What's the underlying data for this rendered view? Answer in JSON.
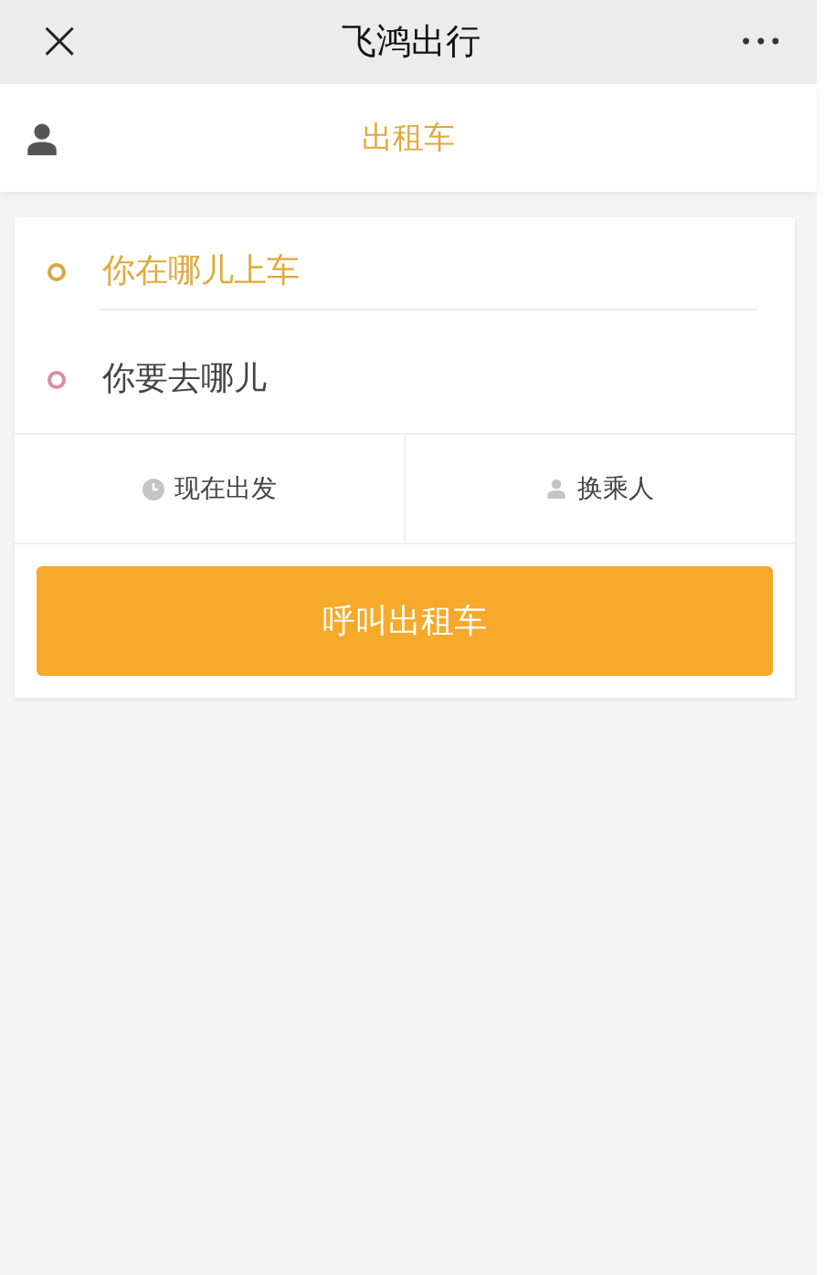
{
  "window": {
    "title": "飞鸿出行",
    "close": "×",
    "more": "•••"
  },
  "service_bar": {
    "title": "出租车"
  },
  "route_fields": [
    {
      "kind": "pickup",
      "placeholder": "你在哪儿上车",
      "color": "#d9a640"
    },
    {
      "kind": "destination",
      "placeholder": "你要去哪儿",
      "color": "#d9909a"
    }
  ],
  "options": [
    {
      "kind": "time",
      "label": "现在出发"
    },
    {
      "kind": "passenger",
      "label": "换乘人"
    }
  ],
  "call_button": {
    "label": "呼叫出租车"
  }
}
